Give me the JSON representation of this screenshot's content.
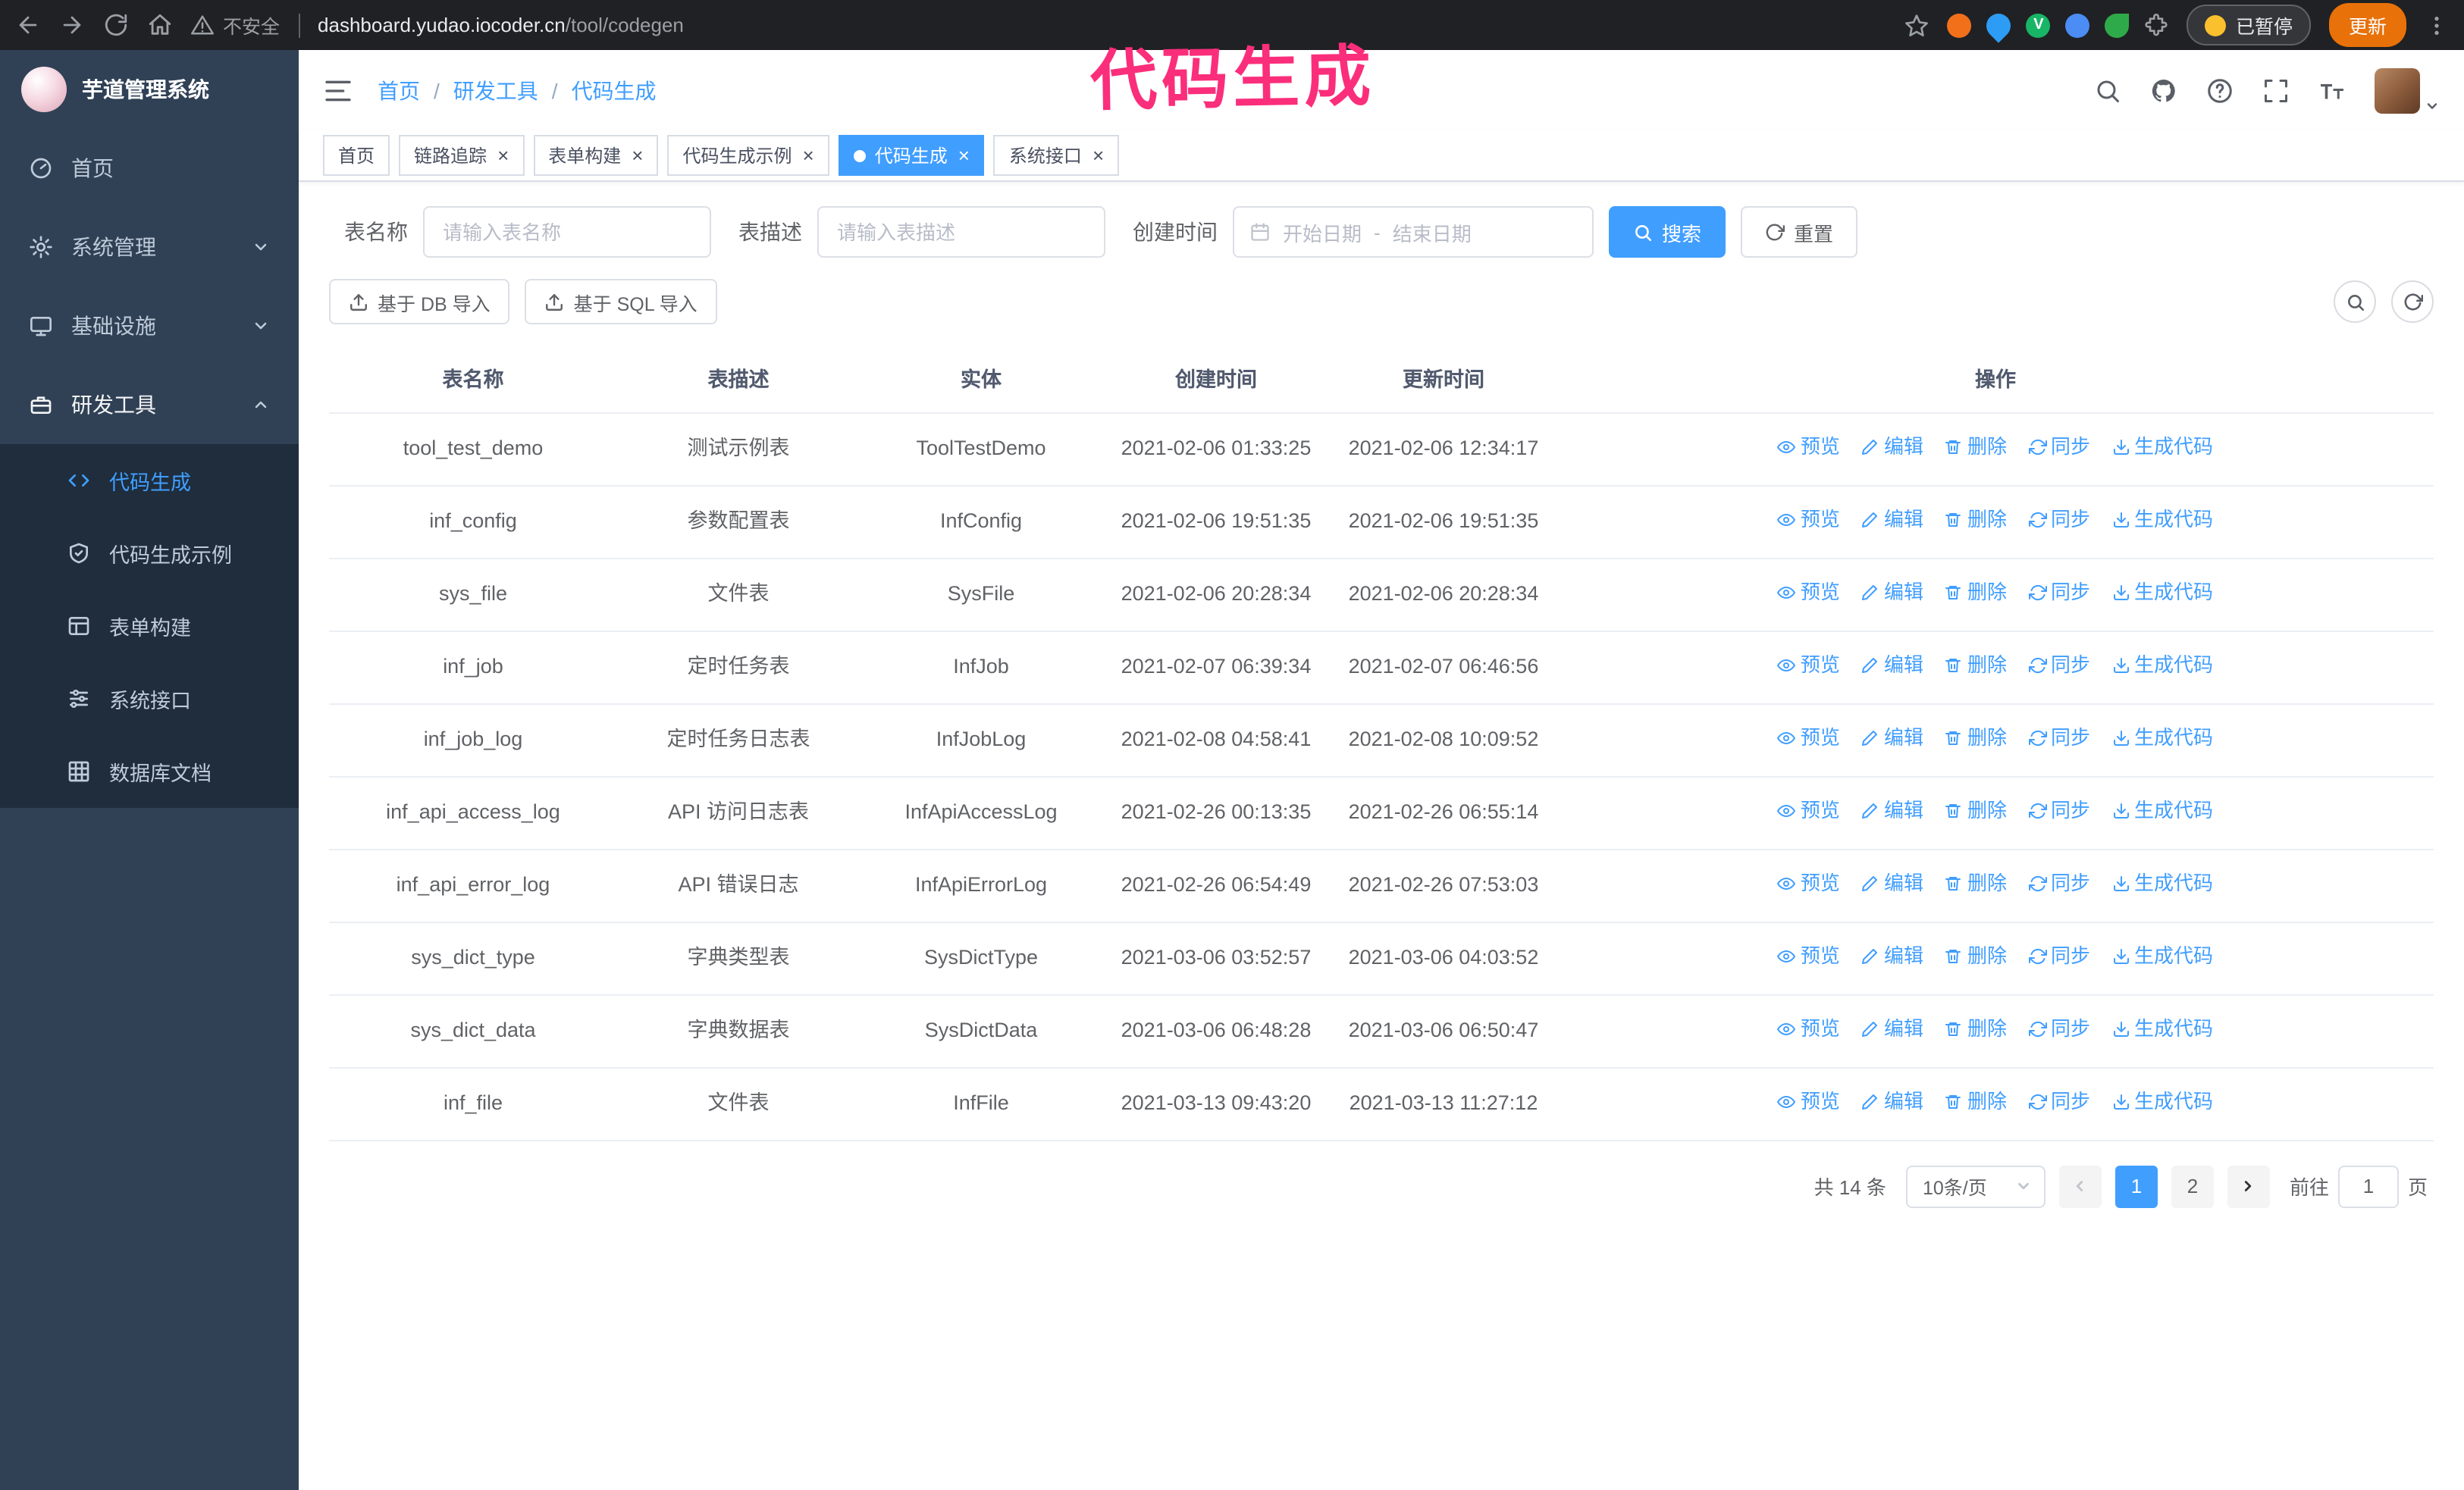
{
  "browser": {
    "security_text": "不安全",
    "url_host": "dashboard.yudao.iocoder.cn",
    "url_path": "/tool/codegen",
    "paused_badge": "已暂停",
    "update_button": "更新"
  },
  "annotation": {
    "text": "代码生成"
  },
  "sidebar": {
    "logo_title": "芋道管理系统",
    "items": [
      {
        "label": "首页"
      },
      {
        "label": "系统管理"
      },
      {
        "label": "基础设施"
      },
      {
        "label": "研发工具"
      }
    ],
    "sub_items": [
      {
        "label": "代码生成",
        "active": true
      },
      {
        "label": "代码生成示例"
      },
      {
        "label": "表单构建"
      },
      {
        "label": "系统接口"
      },
      {
        "label": "数据库文档"
      }
    ]
  },
  "header": {
    "breadcrumb": [
      "首页",
      "研发工具",
      "代码生成"
    ],
    "breadcrumb_separator": "/"
  },
  "tabs": [
    {
      "label": "首页",
      "closable": false,
      "active": false
    },
    {
      "label": "链路追踪",
      "closable": true,
      "active": false
    },
    {
      "label": "表单构建",
      "closable": true,
      "active": false
    },
    {
      "label": "代码生成示例",
      "closable": true,
      "active": false
    },
    {
      "label": "代码生成",
      "closable": true,
      "active": true
    },
    {
      "label": "系统接口",
      "closable": true,
      "active": false
    }
  ],
  "filters": {
    "table_name_label": "表名称",
    "table_name_placeholder": "请输入表名称",
    "table_desc_label": "表描述",
    "table_desc_placeholder": "请输入表描述",
    "create_time_label": "创建时间",
    "start_date_placeholder": "开始日期",
    "range_separator": "-",
    "end_date_placeholder": "结束日期",
    "search_button": "搜索",
    "reset_button": "重置"
  },
  "toolbar": {
    "import_db_label": "基于 DB 导入",
    "import_sql_label": "基于 SQL 导入"
  },
  "table": {
    "columns": [
      "表名称",
      "表描述",
      "实体",
      "创建时间",
      "更新时间",
      "操作"
    ],
    "row_actions": [
      {
        "key": "preview",
        "label": "预览"
      },
      {
        "key": "edit",
        "label": "编辑"
      },
      {
        "key": "delete",
        "label": "删除"
      },
      {
        "key": "sync",
        "label": "同步"
      },
      {
        "key": "generate",
        "label": "生成代码"
      }
    ],
    "rows": [
      {
        "name": "tool_test_demo",
        "desc": "测试示例表",
        "entity": "ToolTestDemo",
        "created": "2021-02-06 01:33:25",
        "updated": "2021-02-06 12:34:17"
      },
      {
        "name": "inf_config",
        "desc": "参数配置表",
        "entity": "InfConfig",
        "created": "2021-02-06 19:51:35",
        "updated": "2021-02-06 19:51:35"
      },
      {
        "name": "sys_file",
        "desc": "文件表",
        "entity": "SysFile",
        "created": "2021-02-06 20:28:34",
        "updated": "2021-02-06 20:28:34"
      },
      {
        "name": "inf_job",
        "desc": "定时任务表",
        "entity": "InfJob",
        "created": "2021-02-07 06:39:34",
        "updated": "2021-02-07 06:46:56"
      },
      {
        "name": "inf_job_log",
        "desc": "定时任务日志表",
        "entity": "InfJobLog",
        "created": "2021-02-08 04:58:41",
        "updated": "2021-02-08 10:09:52"
      },
      {
        "name": "inf_api_access_log",
        "desc": "API 访问日志表",
        "entity": "InfApiAccessLog",
        "created": "2021-02-26 00:13:35",
        "updated": "2021-02-26 06:55:14"
      },
      {
        "name": "inf_api_error_log",
        "desc": "API 错误日志",
        "entity": "InfApiErrorLog",
        "created": "2021-02-26 06:54:49",
        "updated": "2021-02-26 07:53:03"
      },
      {
        "name": "sys_dict_type",
        "desc": "字典类型表",
        "entity": "SysDictType",
        "created": "2021-03-06 03:52:57",
        "updated": "2021-03-06 04:03:52"
      },
      {
        "name": "sys_dict_data",
        "desc": "字典数据表",
        "entity": "SysDictData",
        "created": "2021-03-06 06:48:28",
        "updated": "2021-03-06 06:50:47"
      },
      {
        "name": "inf_file",
        "desc": "文件表",
        "entity": "InfFile",
        "created": "2021-03-13 09:43:20",
        "updated": "2021-03-13 11:27:12"
      }
    ]
  },
  "pagination": {
    "total_label": "共 14 条",
    "page_size": "10条/页",
    "pages": [
      {
        "label": "1",
        "active": true
      },
      {
        "label": "2",
        "active": false
      }
    ],
    "goto_label": "前往",
    "goto_value": "1",
    "goto_unit": "页"
  },
  "colors": {
    "accent": "#409eff",
    "sidebar_bg": "#304156",
    "submenu_bg": "#1f2d3d",
    "annotation": "#fb2e7b",
    "update_button": "#e8710a"
  }
}
